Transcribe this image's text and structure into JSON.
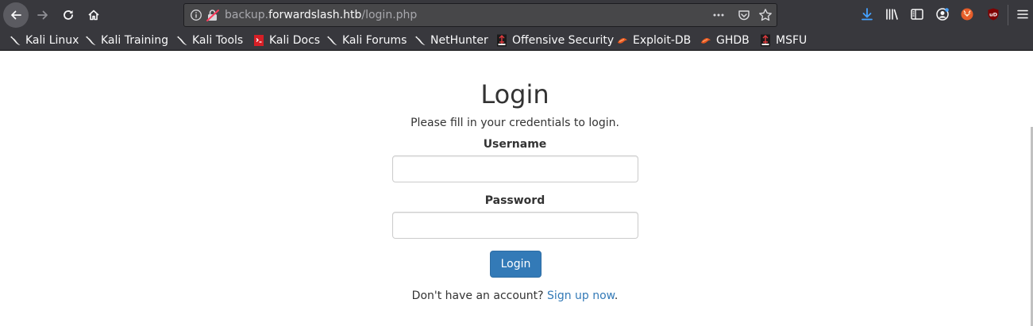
{
  "browser": {
    "url_prefix": "backup.",
    "url_host": "forwardslash.htb",
    "url_path": "/login.php"
  },
  "bookmarks": [
    {
      "label": "Kali Linux",
      "icon": "kali-dragon-icon"
    },
    {
      "label": "Kali Training",
      "icon": "kali-dragon-icon"
    },
    {
      "label": "Kali Tools",
      "icon": "kali-dragon-icon"
    },
    {
      "label": "Kali Docs",
      "icon": "kali-docs-icon"
    },
    {
      "label": "Kali Forums",
      "icon": "kali-dragon-icon"
    },
    {
      "label": "NetHunter",
      "icon": "kali-dragon-icon"
    },
    {
      "label": "Offensive Security",
      "icon": "offsec-icon"
    },
    {
      "label": "Exploit-DB",
      "icon": "exploitdb-icon"
    },
    {
      "label": "GHDB",
      "icon": "exploitdb-icon"
    },
    {
      "label": "MSFU",
      "icon": "offsec-icon"
    }
  ],
  "login": {
    "title": "Login",
    "subtitle": "Please fill in your credentials to login.",
    "username_label": "Username",
    "password_label": "Password",
    "button_label": "Login",
    "signup_prefix": "Don't have an account? ",
    "signup_link": "Sign up now",
    "signup_suffix": "."
  },
  "colors": {
    "chrome": "#38383d",
    "primary_button": "#337ab7",
    "link": "#337ab7",
    "text": "#333333"
  }
}
